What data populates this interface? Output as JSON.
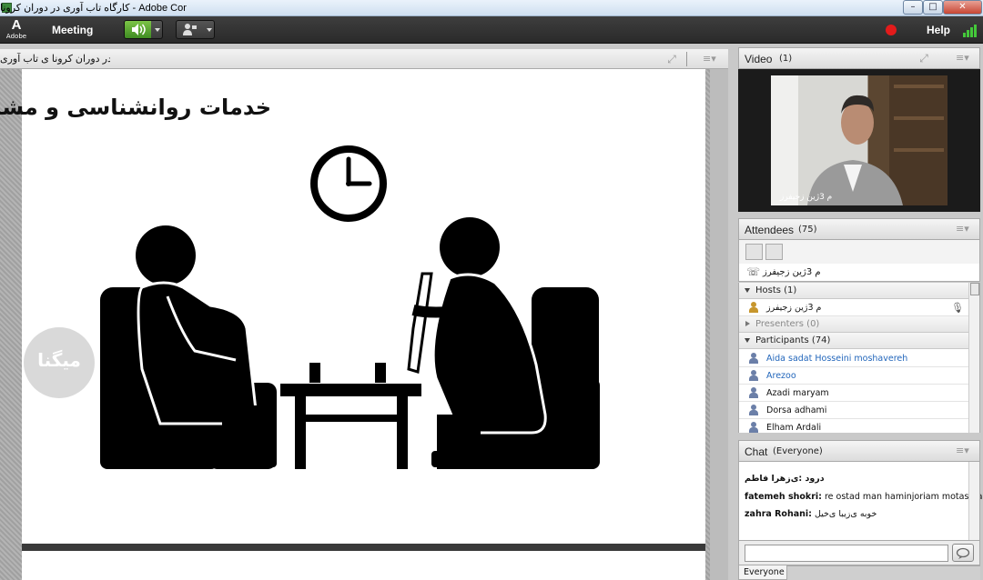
{
  "window": {
    "title": "کارگاه تاب آوری در دوران کرونا - Adobe Connect",
    "min": "–",
    "max": "□",
    "close": "✕"
  },
  "menubar": {
    "logo_glyph": "A",
    "logo_word": "Adobe",
    "meeting": "Meeting",
    "help": "Help",
    "icons": {
      "speaker": "speaker-icon",
      "camera": "camera-icon",
      "record": "record-icon",
      "signal": "signal-bars-icon"
    }
  },
  "share": {
    "filename": "در دوران کرونا ی تاب آوری.pdf",
    "fullscreen_icon": "⤢",
    "menu_icon": "≡▾",
    "slide_title": "خدمات روانشناسی و مشاوره",
    "watermark": "میگنا"
  },
  "video": {
    "title": "Video",
    "count": "(1)",
    "participant_name": "م 3ژین زجیفرز",
    "fullscreen_icon": "⤢",
    "menu_icon": "≡▾"
  },
  "attendees": {
    "title": "Attendees",
    "count": "(75)",
    "menu_icon": "≡▾",
    "me": "م 3ژین زجیفرز",
    "groups": {
      "hosts": "Hosts (1)",
      "presenters": "Presenters (0)",
      "participants": "Participants (74)"
    },
    "hosts": [
      "م 3ژین زجیفرز"
    ],
    "participants": [
      {
        "name": "Aida sadat Hosseini moshavereh",
        "highlight": true
      },
      {
        "name": "Arezoo",
        "highlight": true
      },
      {
        "name": "Azadi maryam",
        "highlight": false
      },
      {
        "name": "Dorsa adhami",
        "highlight": false
      },
      {
        "name": "Elham Ardali",
        "highlight": false
      }
    ]
  },
  "chat": {
    "title": "Chat",
    "scope": "(Everyone)",
    "menu_icon": "≡▾",
    "messages": [
      {
        "sender": "درود :ی‌زهرا فاطم",
        "text": ""
      },
      {
        "sender": "fatemeh shokri:",
        "text": "re ostad man haminjoriam motasefane"
      },
      {
        "sender": "zahra Rohani:",
        "text": "خوبه ی‌زیبا ی‌خیل"
      }
    ],
    "input_value": "",
    "send_icon": "speech-bubble-icon",
    "tab": "Everyone"
  },
  "colors": {
    "accent_green": "#3f8c22",
    "record_red": "#e31b1b",
    "link_blue": "#2266bb"
  }
}
